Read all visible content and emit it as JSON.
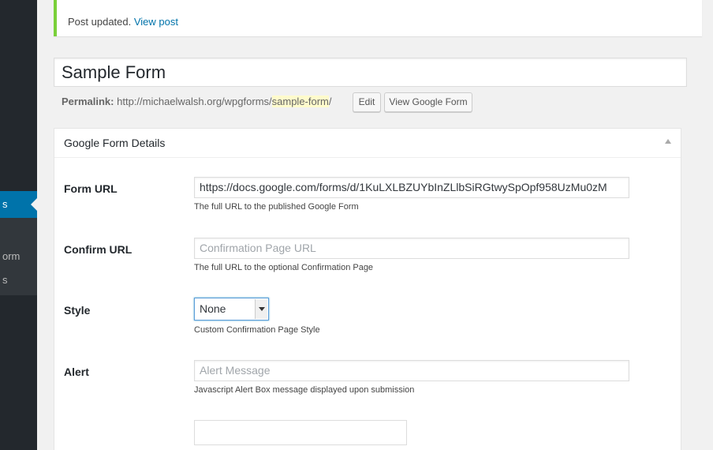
{
  "admin_menu": {
    "current_item": "s",
    "sub_items": [
      "orm",
      "s"
    ]
  },
  "notice": {
    "text": "Post updated.",
    "link": "View post",
    "border_color": "#7ad03a"
  },
  "post": {
    "title": "Sample Form",
    "permalink_label": "Permalink:",
    "permalink_base": "http://michaelwalsh.org/wpgforms/",
    "slug": "sample-form",
    "permalink_trailing": "/",
    "edit_button": "Edit",
    "view_button": "View Google Form"
  },
  "metabox": {
    "title": "Google Form Details",
    "toggle_icon": "triangle-up-icon",
    "fields": {
      "form_url": {
        "label": "Form URL",
        "value": "https://docs.google.com/forms/d/1KuLXLBZUYbInZLlbSiRGtwySpOpf958UzMu0zM",
        "description": "The full URL to the published Google Form"
      },
      "confirm_url": {
        "label": "Confirm URL",
        "placeholder": "Confirmation Page URL",
        "description": "The full URL to the optional Confirmation Page"
      },
      "style": {
        "label": "Style",
        "selected": "None",
        "description": "Custom Confirmation Page Style"
      },
      "alert": {
        "label": "Alert",
        "placeholder": "Alert Message",
        "description": "Javascript Alert Box message displayed upon submission"
      }
    }
  },
  "colors": {
    "accent": "#0073aa",
    "admin_bar": "#23282d",
    "page_bg": "#f1f1f1"
  }
}
